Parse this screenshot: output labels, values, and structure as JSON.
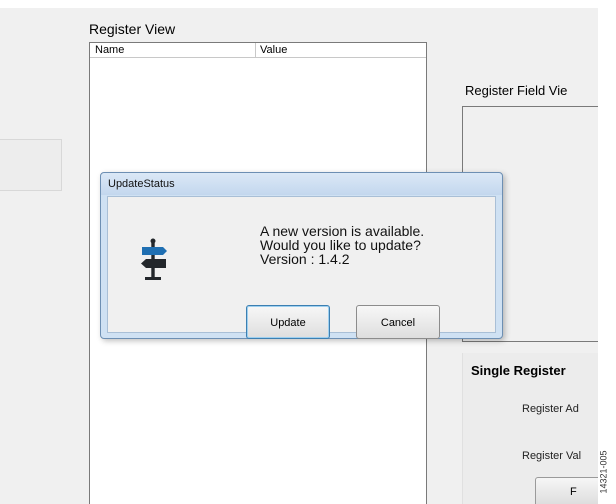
{
  "register_view": {
    "title": "Register View",
    "columns": [
      "Name",
      "Value"
    ]
  },
  "register_field_view": {
    "title": "Register Field Vie"
  },
  "single_register": {
    "title": "Single Register",
    "address_label": "Register Ad",
    "value_label": "Register Val",
    "button_label": "F"
  },
  "dialog": {
    "title": "UpdateStatus",
    "message_lines": [
      "A new version is available.",
      "Would you like to update?",
      "Version : 1.4.2"
    ],
    "update_label": "Update",
    "cancel_label": "Cancel",
    "icon": "signpost-icon"
  },
  "figure_number": "14321-005",
  "colors": {
    "signpost_blue": "#1f6fb2",
    "signpost_dark": "#23272b",
    "dialog_frame": "#cfe1f3",
    "focus_border": "#3c7fb1"
  }
}
